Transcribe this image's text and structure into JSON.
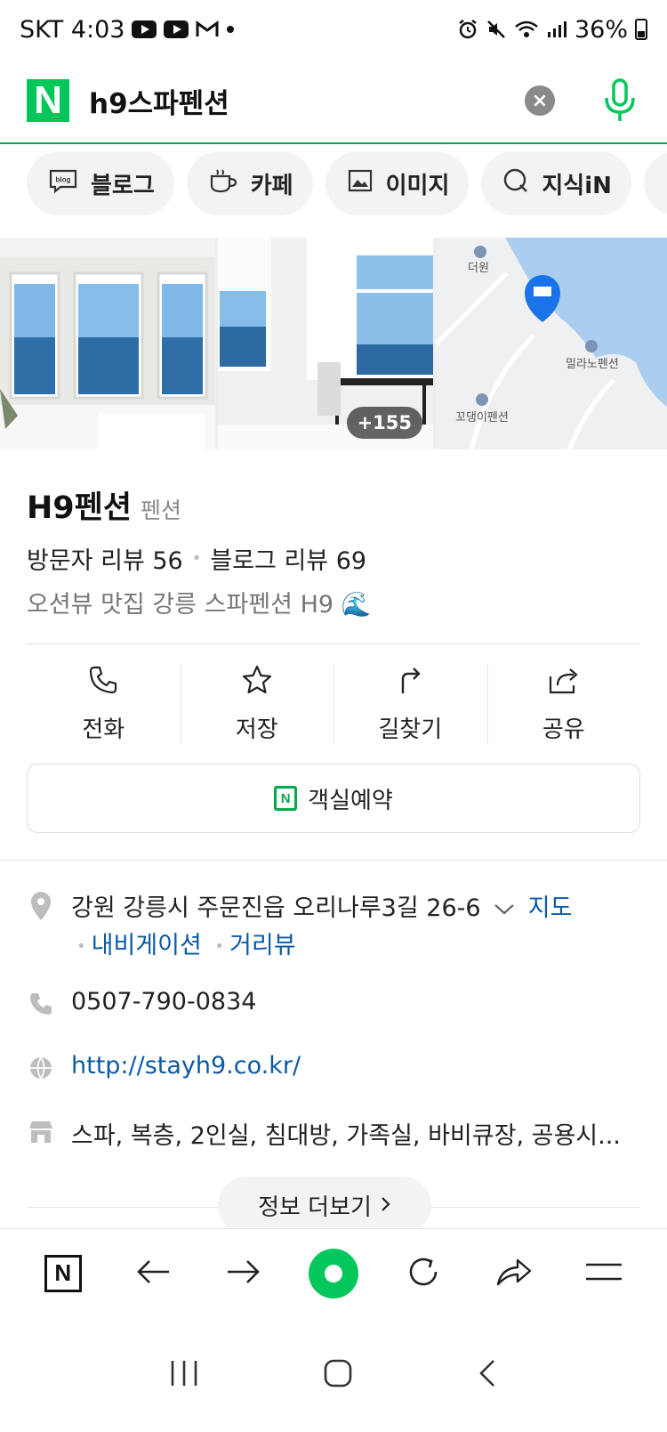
{
  "status_bar": {
    "carrier_time": "SKT 4:03",
    "battery": "36%"
  },
  "search": {
    "logo": "N",
    "query": "h9스파펜션",
    "clear_label": "×"
  },
  "tabs": [
    {
      "label": "블로그",
      "icon": "blog-icon"
    },
    {
      "label": "카페",
      "icon": "cafe-icon"
    },
    {
      "label": "이미지",
      "icon": "image-icon"
    },
    {
      "label": "지식iN",
      "icon": "knowledge-icon"
    }
  ],
  "photos": {
    "more_count": "+155",
    "map_labels": [
      "더원",
      "밀라노펜션",
      "꼬댕이펜션"
    ]
  },
  "place": {
    "name": "H9펜션",
    "category": "펜션",
    "visitor_reviews": "방문자 리뷰 56",
    "blog_reviews": "블로그 리뷰 69",
    "description": "오션뷰 맛집 강릉 스파펜션 H9 🌊"
  },
  "actions": [
    {
      "label": "전화",
      "icon": "phone-icon"
    },
    {
      "label": "저장",
      "icon": "star-icon"
    },
    {
      "label": "길찾기",
      "icon": "directions-icon"
    },
    {
      "label": "공유",
      "icon": "share-icon"
    }
  ],
  "reserve_label": "객실예약",
  "details": {
    "address": "강원 강릉시 주문진읍 오리나루3길 26-6",
    "map_link": "지도",
    "navigation_link": "내비게이션",
    "street_view_link": "거리뷰",
    "phone": "0507-790-0834",
    "website": "http://stayh9.co.kr/",
    "facilities": "스파, 복층, 2인실, 침대방, 가족실, 바비큐장, 공용시..."
  },
  "more_info_label": "정보 더보기",
  "colors": {
    "naver_green": "#03c75a",
    "link_blue": "#0b5aa6",
    "pin_blue": "#1a73e8"
  }
}
